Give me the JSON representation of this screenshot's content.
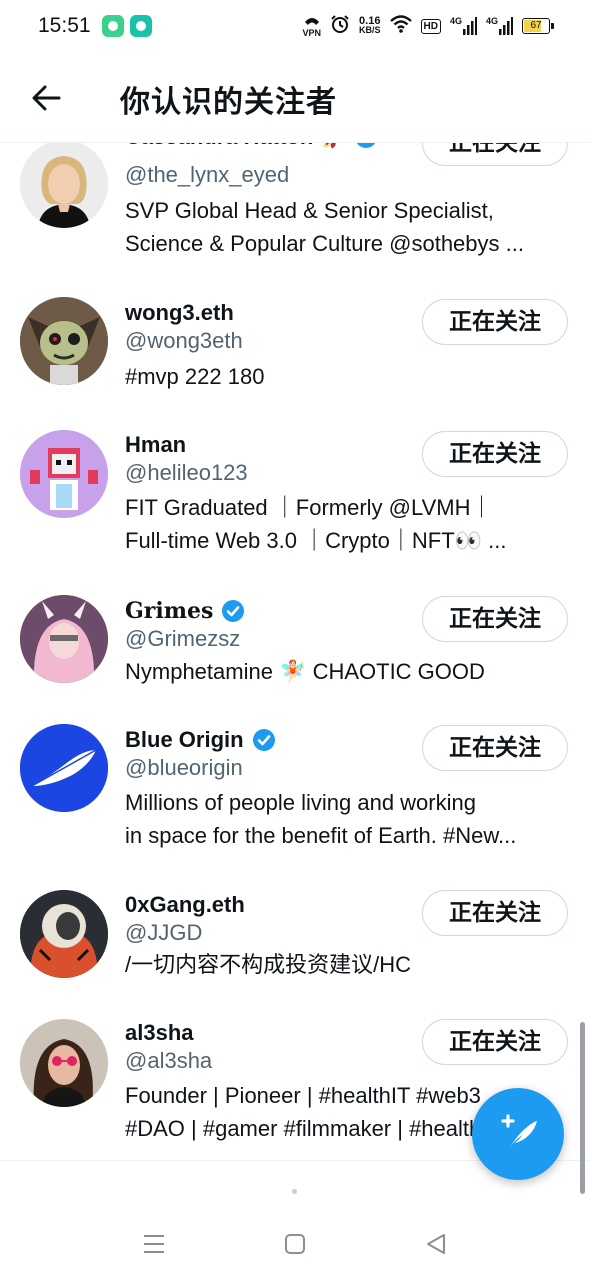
{
  "status_bar": {
    "time": "15:51",
    "vpn": "VPN",
    "speed_value": "0.16",
    "speed_unit": "KB/S",
    "hd": "HD",
    "net1": "4G",
    "net2": "4G",
    "battery": "67",
    "icons": [
      "phone-app-icon",
      "message-app-icon",
      "vpn-icon",
      "alarm-icon",
      "wifi-icon",
      "hd-icon",
      "signal-icon",
      "battery-icon"
    ]
  },
  "header": {
    "title": "你认识的关注者",
    "back_icon": "arrow-left-icon"
  },
  "follow_label": "正在关注",
  "users": [
    {
      "name": "Cassandra Hatton",
      "emoji": "🚀",
      "verified": true,
      "handle": "@the_lynx_eyed",
      "bio": [
        "SVP Global Head & Senior Specialist,",
        "Science & Popular Culture @sothebys ..."
      ]
    },
    {
      "name": "wong3.eth",
      "verified": false,
      "handle": "@wong3eth",
      "bio": [
        "#mvp 222 180"
      ]
    },
    {
      "name": "Hman",
      "verified": false,
      "handle": "@helileo123",
      "bio": [
        "FIT Graduated ｜Formerly @LVMH｜",
        "Full-time Web 3.0 ｜Crypto｜NFT👀 ..."
      ]
    },
    {
      "name": "Grimes",
      "verified": true,
      "handle": "@Grimezsz",
      "bio": [
        "Nymphetamine 🧚🏻 CHAOTIC GOOD"
      ]
    },
    {
      "name": "Blue Origin",
      "verified": true,
      "handle": "@blueorigin",
      "bio": [
        "Millions of people living and working",
        "in space for the benefit of Earth. #New..."
      ]
    },
    {
      "name": "0xGang.eth",
      "verified": false,
      "handle": "@JJGD",
      "bio": [
        "/一切内容不构成投资建议/HC"
      ]
    },
    {
      "name": "al3sha",
      "verified": false,
      "handle": "@al3sha",
      "bio": [
        "Founder | Pioneer | #healthIT #web3",
        "#DAO | #gamer #filmmaker | #healthtech"
      ]
    }
  ],
  "colors": {
    "accent": "#1d9bf0",
    "text": "#0f1419",
    "secondary_text": "#536471",
    "button_border": "#cfd9de"
  },
  "fab_icon": "compose-feather-plus-icon",
  "nav_icons": [
    "menu-icon",
    "home-square-icon",
    "back-triangle-icon"
  ]
}
